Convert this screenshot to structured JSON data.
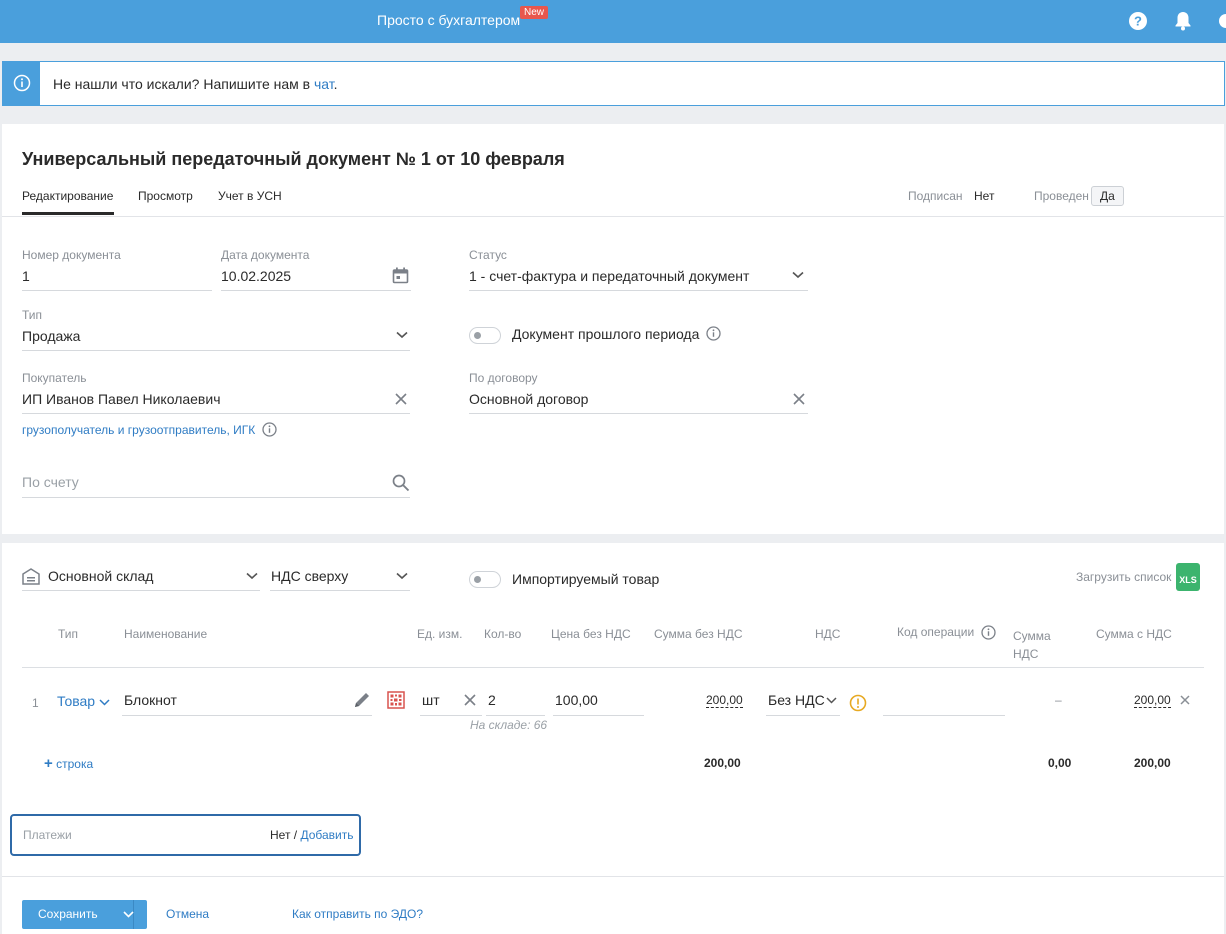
{
  "header": {
    "brand": "Просто с бухгалтером",
    "new_badge": "New"
  },
  "banner": {
    "text": "Не нашли что искали? Напишите нам в ",
    "link": "чат",
    "tail": "."
  },
  "doc": {
    "title": "Универсальный передаточный документ № 1 от 10 февраля",
    "tabs": [
      "Редактирование",
      "Просмотр",
      "Учет в УСН"
    ],
    "signed_label": "Подписан",
    "signed_value": "Нет",
    "posted_label": "Проведен",
    "posted_value": "Да"
  },
  "form": {
    "doc_number_label": "Номер документа",
    "doc_number": "1",
    "doc_date_label": "Дата документа",
    "doc_date": "10.02.2025",
    "status_label": "Статус",
    "status": "1 - счет-фактура и передаточный документ",
    "type_label": "Тип",
    "type": "Продажа",
    "past_period_label": "Документ прошлого периода",
    "buyer_label": "Покупатель",
    "buyer": "ИП Иванов Павел Николаевич",
    "contract_label": "По договору",
    "contract": "Основной договор",
    "consignee_link": "грузополучатель и грузоотправитель, ИГК",
    "invoice_placeholder": "По счету"
  },
  "items": {
    "warehouse": "Основной склад",
    "vat_mode": "НДС сверху",
    "imported_label": "Импортируемый товар",
    "upload_label": "Загрузить список",
    "xls": "XLS",
    "headers": {
      "type": "Тип",
      "name": "Наименование",
      "unit": "Ед. изм.",
      "qty": "Кол-во",
      "price": "Цена без НДС",
      "sum": "Сумма без НДС",
      "vat": "НДС",
      "op_code": "Код операции",
      "vat_sum": "Сумма НДС",
      "total": "Сумма с НДС"
    },
    "rows": [
      {
        "num": "1",
        "type": "Товар",
        "name": "Блокнот",
        "unit": "шт",
        "qty": "2",
        "stock": "На складе: 66",
        "price": "100,00",
        "sum": "200,00",
        "vat": "Без НДС",
        "vat_sum": "–",
        "total": "200,00"
      }
    ],
    "add_row": "строка",
    "totals": {
      "sum": "200,00",
      "vat_sum": "0,00",
      "total": "200,00"
    }
  },
  "payments": {
    "label": "Платежи",
    "value": "Нет",
    "sep": " / ",
    "add": "Добавить"
  },
  "footer": {
    "save": "Сохранить",
    "cancel": "Отмена",
    "edo": "Как отправить по ЭДО?"
  }
}
